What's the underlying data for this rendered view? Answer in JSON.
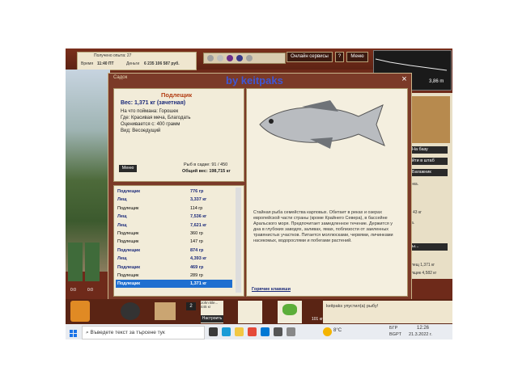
{
  "topbar": {
    "experience": "Получено опыта: 27",
    "time_label": "Время",
    "time_value": "11:40 ПТ",
    "money_label": "Деньги",
    "money_value": "6 235 106 587 руб.",
    "online_button": "Онлайн сервисы",
    "help_button": "?",
    "menu_button": "Меню",
    "depth": "3,86 m"
  },
  "right_panel": {
    "to_base": "На базу",
    "to_hq": "йти в штаб",
    "trunk": "Багажник",
    "text_frag_1": "чка.",
    "text_frag_2": "43 кг",
    "text_frag_3": "а.",
    "text_frag_4": "ы...",
    "text_frag_5": "лещ 1,371 кг",
    "text_frag_6": "лщик 4,582 кг",
    "text_frag_7": "43 кг"
  },
  "dialog": {
    "title": "Садок",
    "watermark": "by keitpaks",
    "close": "×",
    "fish_name": "Подлещик",
    "weight": "Вес: 1,371 кг (зачетная)",
    "bait": "На что поймана: Горошек",
    "place": "Где: Красивая меча, Благодать",
    "valued": "Оценивается с: 400 грамм",
    "kind": "Вид: Весоедущий",
    "menu_button": "Меню",
    "in_keepnet": "Рыб в садке: 91 / 450",
    "total_weight": "Общий вес: 198,715 кг",
    "description": "Стайная рыба семейства карповых. Обитает в реках и озерах европейской части страны (кроме Крайнего Севера), в бассейне Аральского моря. Предпочитает замедленное течение. Держится у дна в глубоких заводях, заливах, ямах, поблизости от заиленных травянистых участков. Питается моллюсками, червями, личинками насекомых, водорослями и побегами растений.",
    "hotkeys": "Горячие клавиши",
    "catch": [
      {
        "name": "Подлещик",
        "weight": "776 гр",
        "style": "bold"
      },
      {
        "name": "Лещ",
        "weight": "3,337 кг",
        "style": "bold"
      },
      {
        "name": "Подлещик",
        "weight": "114 гр",
        "style": "normal"
      },
      {
        "name": "Лещ",
        "weight": "7,536 кг",
        "style": "bold"
      },
      {
        "name": "Лещ",
        "weight": "7,621 кг",
        "style": "bold"
      },
      {
        "name": "Подлещик",
        "weight": "360 гр",
        "style": "normal"
      },
      {
        "name": "Подлещик",
        "weight": "147 гр",
        "style": "normal"
      },
      {
        "name": "Подлещик",
        "weight": "874 гр",
        "style": "bold"
      },
      {
        "name": "Лещ",
        "weight": "4,393 кг",
        "style": "bold"
      },
      {
        "name": "Подлещик",
        "weight": "469 гр",
        "style": "bold"
      },
      {
        "name": "Подлещик",
        "weight": "289 гр",
        "style": "normal"
      },
      {
        "name": "Подлещик",
        "weight": "1,371 кг",
        "style": "selected"
      }
    ]
  },
  "bottom": {
    "count": "2",
    "lure_name": "John Ble...",
    "lure_weight": "445 кг",
    "setup_button": "Настроить",
    "cup_label": "101 кг",
    "chat_text": "keitpaks упустил(а) рыбу!",
    "meter_a": "0:0",
    "meter_b": "0:0"
  },
  "taskbar": {
    "search_placeholder": "Въведете текст за търсене тук",
    "temperature": "8°C",
    "lang_1": "БГР",
    "lang_2": "BGPT",
    "time": "12:26",
    "date": "21.3.2022 г."
  }
}
